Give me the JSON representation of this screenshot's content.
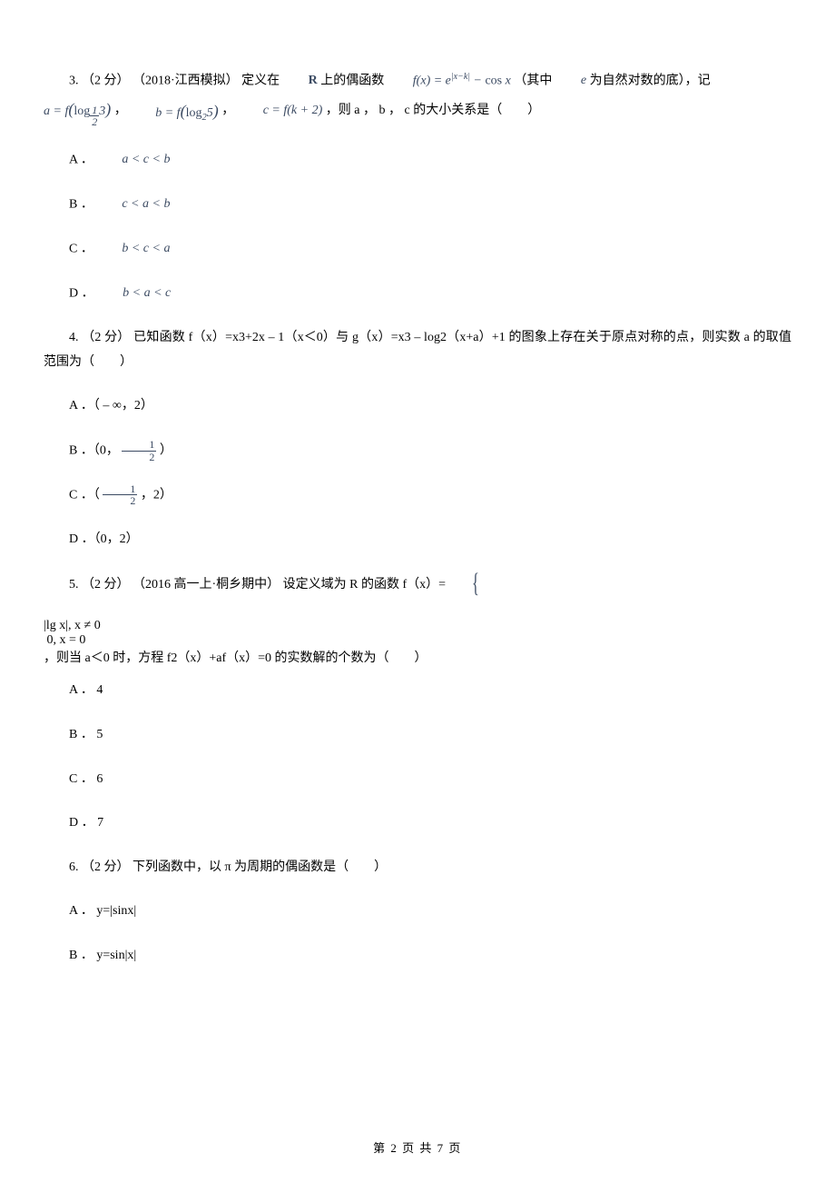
{
  "q3": {
    "stem_a": "3. （2 分） （2018·江西模拟） 定义在 ",
    "stem_R": "R",
    "stem_b": " 上的偶函数 ",
    "stem_fx": "f(x) = e|x−k| − cos x",
    "stem_c": " （其中 ",
    "stem_e": "e",
    "stem_d": " 为自然对数的底），记 ",
    "stem_af": "a = f(log_{1/2} 3)",
    "stem_sep1": " ， ",
    "stem_bf": "b = f(log_2 5)",
    "stem_sep2": " ， ",
    "stem_cf": "c = f(k + 2)",
    "stem_tail": " ，则 a  ， b  ， c  的大小关系是（　　）",
    "opts": {
      "A": "A ．",
      "A_math": "a < c < b",
      "B": "B ．",
      "B_math": "c < a < b",
      "C": "C ．",
      "C_math": "b < c < a",
      "D": "D ．",
      "D_math": "b < a < c"
    }
  },
  "q4": {
    "stem": "4. （2 分）  已知函数 f（x）=x3+2x – 1（x＜0）与 g（x）=x3 – log2（x+a）+1 的图象上存在关于原点对称的点，则实数 a 的取值范围为（　　）",
    "opts": {
      "A": "A ．（ – ∞，2）",
      "B_pre": "B ．（0， ",
      "B_frac_top": "1",
      "B_frac_bot": "2",
      "B_post": " ）",
      "C_pre": "C ．（ ",
      "C_frac_top": "1",
      "C_frac_bot": "2",
      "C_post": " ，2）",
      "D": "D ．（0，2）"
    }
  },
  "q5": {
    "stem_a": "5. （2 分） （2016 高一上·桐乡期中） 设定义域为 R 的函数 f（x）= ",
    "piece_top": "|lg x|, x ≠ 0",
    "piece_bot": "0, x = 0",
    "stem_b": "  ，则当 a＜0 时，方程 f2（x）+af（x）=0 的实数解的个数为（　　）",
    "opts": {
      "A": "A ． 4",
      "B": "B ． 5",
      "C": "C ． 6",
      "D": "D ． 7"
    }
  },
  "q6": {
    "stem": "6. （2 分）  下列函数中，以 π  为周期的偶函数是（　　）",
    "opts": {
      "A": "A ． y=|sinx|",
      "B": "B ． y=sin|x|"
    }
  },
  "footer": "第 2 页 共 7 页"
}
